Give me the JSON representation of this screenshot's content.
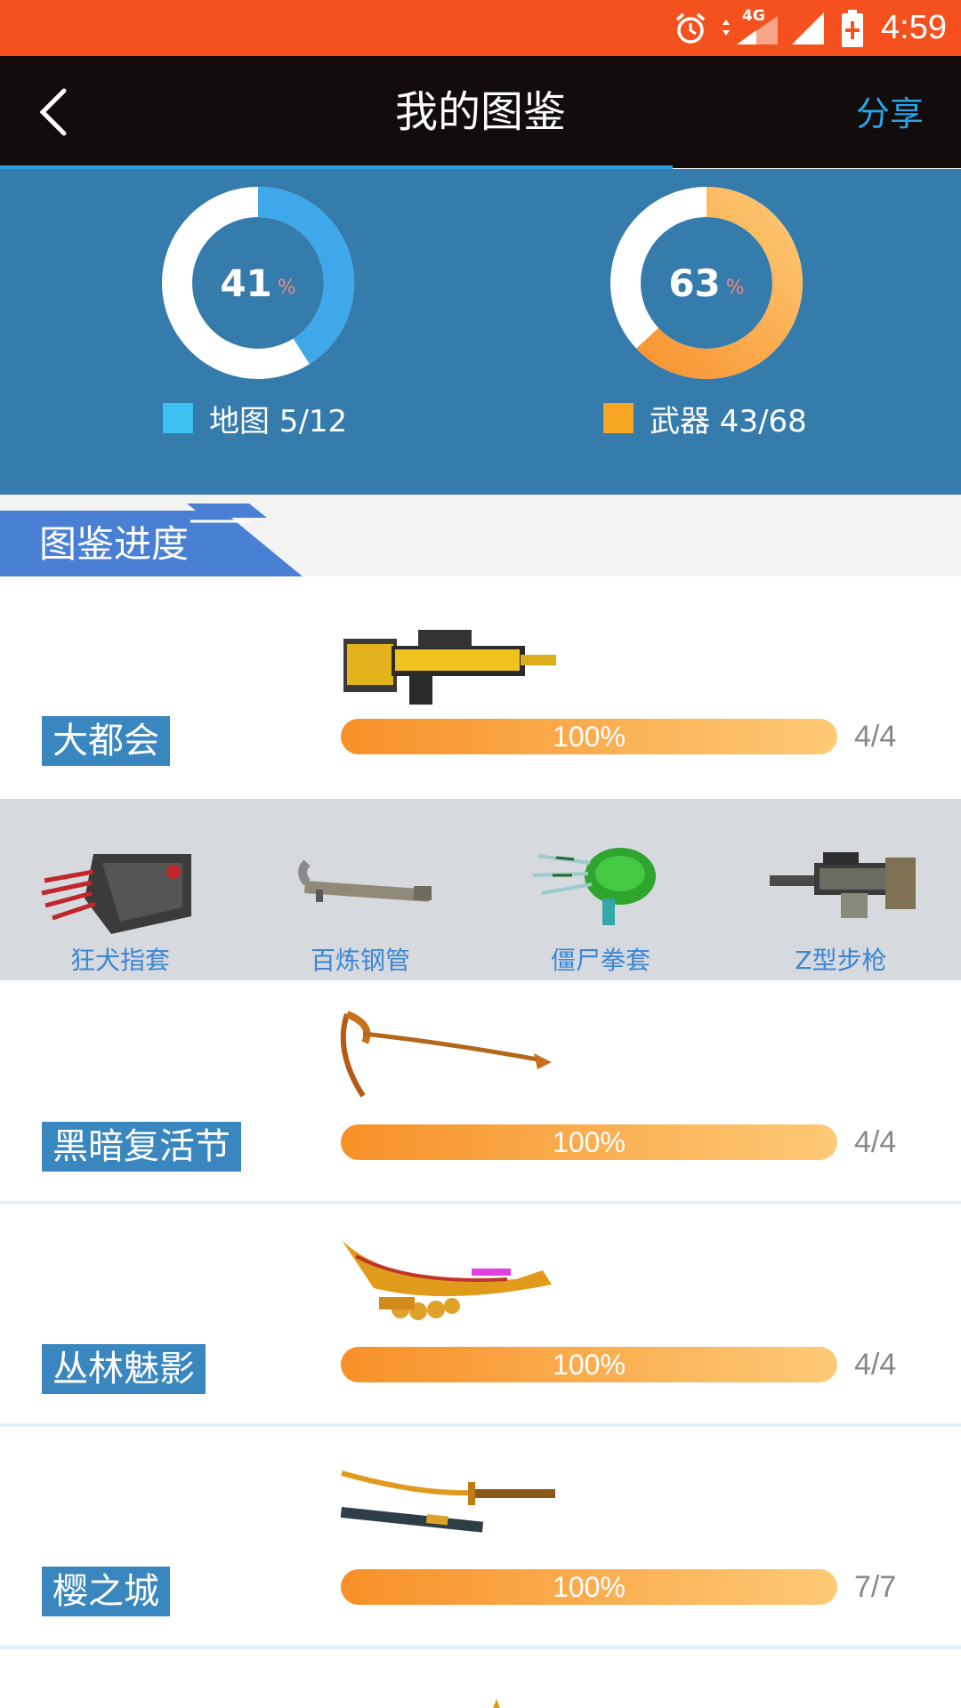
{
  "status_bar": {
    "network": "4G",
    "time": "4:59"
  },
  "header": {
    "title": "我的图鉴",
    "share_label": "分享"
  },
  "stats": {
    "map": {
      "percent_value": "41",
      "percent_sign": "%",
      "label": "地图 5/12",
      "fraction": 0.41,
      "color": "#3fb5ef"
    },
    "weapon": {
      "percent_value": "63",
      "percent_sign": "%",
      "label": "武器 43/68",
      "fraction": 0.63,
      "color": "#f7a23a"
    }
  },
  "section": {
    "title": "图鉴进度"
  },
  "progress_rows": [
    {
      "name": "大都会",
      "percent": "100%",
      "count": "4/4",
      "fraction": 1.0
    },
    {
      "name": "黑暗复活节",
      "percent": "100%",
      "count": "4/4",
      "fraction": 1.0
    },
    {
      "name": "丛林魅影",
      "percent": "100%",
      "count": "4/4",
      "fraction": 1.0
    },
    {
      "name": "樱之城",
      "percent": "100%",
      "count": "7/7",
      "fraction": 1.0
    }
  ],
  "gallery": {
    "items": [
      {
        "name": "狂犬指套"
      },
      {
        "name": "百炼钢管"
      },
      {
        "name": "僵尸拳套"
      },
      {
        "name": "Z型步枪"
      }
    ]
  },
  "colors": {
    "status_bar": "#F4511E",
    "header": "#120c0c",
    "stats_bg": "#357bab",
    "accent": "#29a3e6",
    "progress_start": "#f79028",
    "progress_end": "#fdca76",
    "name_tag": "#3a86bf"
  }
}
